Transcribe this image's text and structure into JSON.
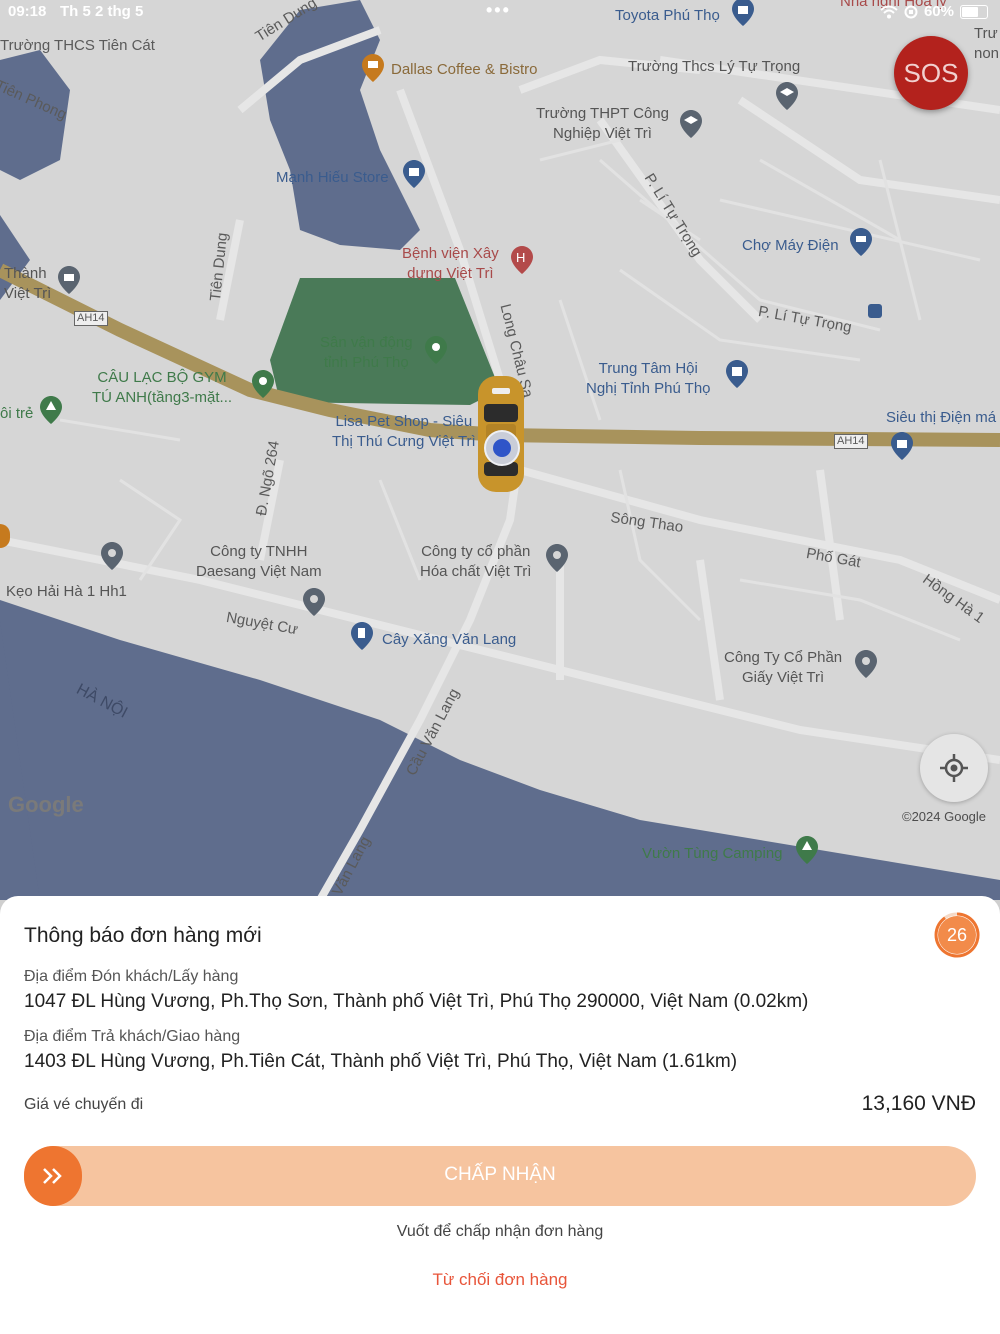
{
  "status_bar": {
    "time": "09:18",
    "date": "Th 5 2 thg 5",
    "battery": "60%"
  },
  "map": {
    "places": {
      "toyota": "Toyota Phú Thọ",
      "nha_nghi": "Nhà nghỉ Hoa ly",
      "thcs_tien_cat": "Trường THCS Tiên Cát",
      "tien_dung_1": "Tiên Dung",
      "dallas": "Dallas Coffee & Bistro",
      "thcs_ly_tu_trong": "Trường Thcs Lý Tự Trọng",
      "tien_phong": "Tiên Phong",
      "thpt_cong_nghiep_1": "Trường THPT Công",
      "thpt_cong_nghiep_2": "Nghiệp Việt Trì",
      "tru_non_1": "Trư",
      "tru_non_2": "non",
      "manh_hieu": "Mạnh Hiếu Store",
      "p_ly_tu_trong_1": "P. Lí Tự Trọng",
      "benh_vien_1": "Bệnh viện Xây",
      "benh_vien_2": "dựng Việt Trì",
      "cho_may_dien": "Chợ Máy Điện",
      "tien_dung_2": "Tiên Dung",
      "thanh_1": "Thành",
      "thanh_2": "Việt Trì",
      "ah14_a": "AH14",
      "p_ly_tu_trong_2": "P. Lí Tự Trọng",
      "long_chau_sa": "Long Châu Sa",
      "svd_1": "Sân vận động",
      "svd_2": "tỉnh Phú Thọ",
      "gym_1": "CÂU LẠC BỘ GYM",
      "gym_2": "TÚ ANH(tầng3-mặt...",
      "trung_tam_1": "Trung Tâm Hội",
      "trung_tam_2": "Nghị Tỉnh Phú Thọ",
      "oi_tre": "ôi trẻ",
      "lisa_1": "Lisa Pet Shop - Siêu",
      "lisa_2": "Thị Thú Cưng Việt Trì",
      "sieu_thi": "Siêu thị Điện má",
      "ah14_b": "AH14",
      "ngo_264": "Đ. Ngõ 264",
      "song_thao": "Sông Thao",
      "pho_gat": "Phố Gát",
      "daesang_1": "Công ty TNHH",
      "daesang_2": "Daesang Việt Nam",
      "hoa_chat_1": "Công ty cổ phần",
      "hoa_chat_2": "Hóa chất Việt Trì",
      "hong_ha": "Hồng Hà 1",
      "keo_hai_ha": "Kẹo Hải Hà 1 Hh1",
      "nguyet_cu": "Nguyệt Cư",
      "cay_xang": "Cây Xăng Văn Lang",
      "giay_1": "Công Ty Cổ Phần",
      "giay_2": "Giấy Việt Trì",
      "ha_noi": "HÀ NỘI",
      "cau_van_lang": "Cầu Văn Lang",
      "van_lang": "Văn Lang",
      "vuon_tung": "Vườn Tùng Camping"
    },
    "google_logo": "Google",
    "copyright": "©2024 Google"
  },
  "sos_label": "SOS",
  "order": {
    "title": "Thông báo đơn hàng mới",
    "countdown": "26",
    "pickup_label": "Địa điểm Đón khách/Lấy hàng",
    "pickup_address": "1047 ĐL Hùng Vương, Ph.Thọ Sơn, Thành phố Việt Trì, Phú Thọ 290000, Việt Nam (0.02km)",
    "dropoff_label": "Địa điểm Trả khách/Giao hàng",
    "dropoff_address": "1403 ĐL Hùng Vương, Ph.Tiên Cát, Thành phố Việt Trì, Phú Thọ, Việt Nam (1.61km)",
    "fare_label": "Giá vé chuyến đi",
    "fare_value": "13,160 VNĐ",
    "accept_label": "CHẤP NHẬN",
    "swipe_hint": "Vuốt để chấp nhận đơn hàng",
    "reject_label": "Từ chối đơn hàng"
  },
  "colors": {
    "accent": "#ee7530",
    "accent_light": "#f6c49f",
    "reject": "#e8553a",
    "sos": "#b3221d"
  }
}
